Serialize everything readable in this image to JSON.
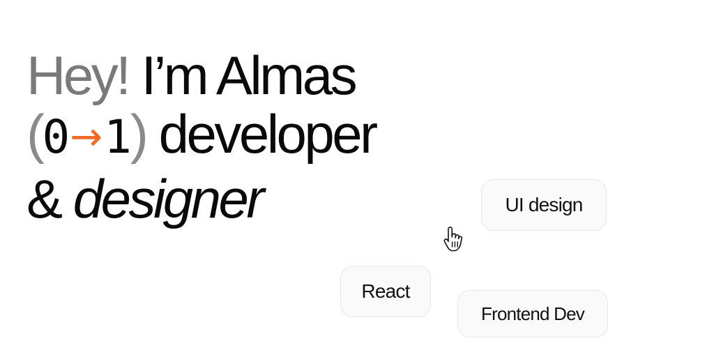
{
  "hero": {
    "line1": {
      "greeting": "Hey!",
      "name": "I’m Almas"
    },
    "line2": {
      "paren_open": "(",
      "from": "0",
      "arrow": "→",
      "to": "1",
      "paren_close": ")",
      "role": "developer"
    },
    "line3": {
      "ampersand": "&",
      "role": "designer"
    }
  },
  "skills": {
    "ui_design": "UI design",
    "react": "React",
    "frontend": "Frontend Dev"
  },
  "colors": {
    "accent": "#f06a24",
    "muted_text": "#7a7a7a",
    "text": "#0a0a0a",
    "chip_bg": "#fafafa",
    "chip_border": "#e6e6e6"
  },
  "icons": {
    "cursor": "pointer-hand-icon"
  }
}
